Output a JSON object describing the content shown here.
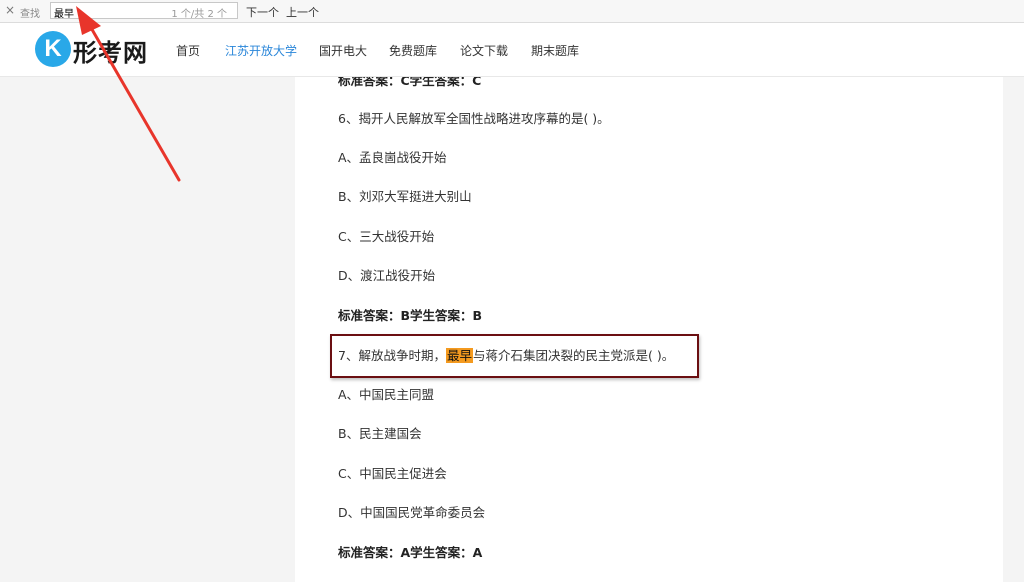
{
  "findbar": {
    "close_glyph": "×",
    "label": "查找",
    "query": "最早",
    "count": "1 个/共 2 个",
    "next": "下一个",
    "prev": "上一个"
  },
  "header": {
    "logo_letter": "K",
    "logo_text": "形考网",
    "nav": [
      "首页",
      "江苏开放大学",
      "国开电大",
      "免费题库",
      "论文下载",
      "期末题库"
    ],
    "active_nav": "江苏开放大学"
  },
  "content": {
    "cut_answer": "标准答案：C学生答案：C",
    "q6": {
      "text": "6、揭开人民解放军全国性战略进攻序幕的是( )。",
      "options": [
        "A、孟良崮战役开始",
        "B、刘邓大军挺进大别山",
        "C、三大战役开始",
        "D、渡江战役开始"
      ],
      "answer": "标准答案：B学生答案：B"
    },
    "q7": {
      "prefix": "7、解放战争时期，",
      "highlight": "最早",
      "suffix": "与蒋介石集团决裂的民主党派是( )。",
      "options": [
        "A、中国民主同盟",
        "B、民主建国会",
        "C、中国民主促进会",
        "D、中国国民党革命委员会"
      ],
      "answer": "标准答案：A学生答案：A"
    }
  },
  "colors": {
    "accent": "#2a86d9",
    "logo_blue": "#29a8e8",
    "highlight": "#f49a1f",
    "focus_border": "#6b0f12",
    "arrow": "#e8352b"
  }
}
